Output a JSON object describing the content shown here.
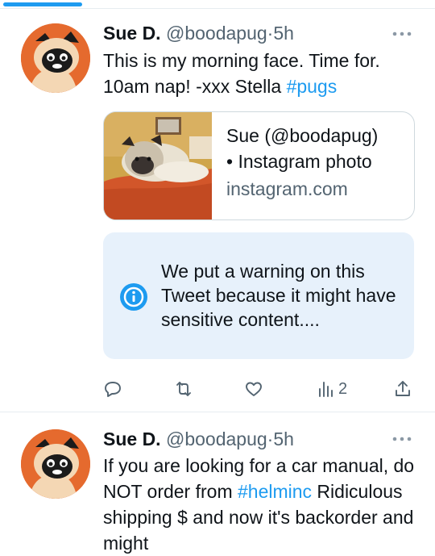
{
  "colors": {
    "accent": "#1d9bf0",
    "muted": "#536471",
    "text": "#0f1419",
    "avatar_bg": "#e56a2e",
    "warning_bg": "#e7f1fb"
  },
  "tweets": [
    {
      "name": "Sue D.",
      "handle": "@boodapug",
      "dot": "·",
      "time": "5h",
      "text_parts": [
        "This is my morning face. Time for. 10am nap! -xxx Stella ",
        "#pugs"
      ],
      "card": {
        "title_line1": "Sue (@boodapug)",
        "title_line2": "• Instagram photo",
        "domain": "instagram.com",
        "image_alt": "pug-on-blanket-photo"
      },
      "warning": {
        "text": "We put a warning on this Tweet because it might have sensitive content...."
      },
      "actions": {
        "reply_icon": "reply-icon",
        "retweet_icon": "retweet-icon",
        "like_icon": "heart-icon",
        "views_icon": "views-icon",
        "views_count": "2",
        "share_icon": "share-icon"
      }
    },
    {
      "name": "Sue D.",
      "handle": "@boodapug",
      "dot": "·",
      "time": "5h",
      "text_parts": [
        "If you are looking for a car manual, do NOT order from ",
        "#helminc",
        " Ridiculous shipping $ and now it's backorder and might"
      ]
    }
  ]
}
